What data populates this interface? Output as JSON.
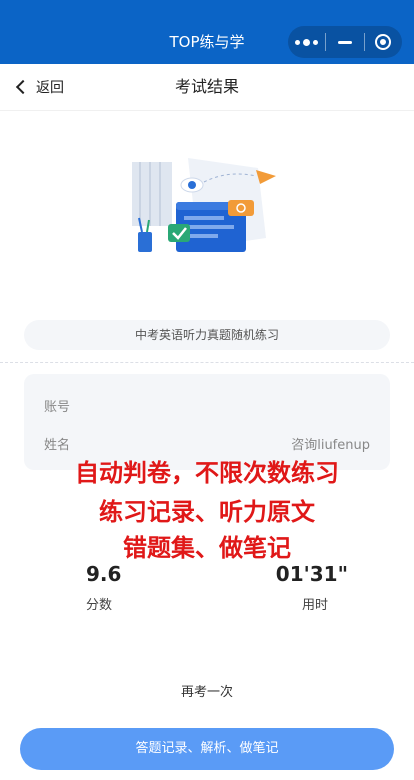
{
  "app": {
    "title": "TOP练与学"
  },
  "nav": {
    "back_label": "返回",
    "title": "考试结果"
  },
  "exam": {
    "name": "中考英语听力真题随机练习"
  },
  "info": {
    "account_label": "账号",
    "account_value": "",
    "name_label": "姓名",
    "name_value": "咨询liufenup"
  },
  "overlay": {
    "line1": "自动判卷，不限次数练习",
    "line2": "练习记录、听力原文",
    "line3": "错题集、做笔记"
  },
  "result": {
    "score_value": "9.6",
    "score_label": "分数",
    "time_value": "01'31\"",
    "time_label": "用时"
  },
  "actions": {
    "retake_label": "再考一次",
    "records_label": "答题记录、解析、做笔记"
  },
  "colors": {
    "topbar": "#0b64c6",
    "cta": "#5a9bf6",
    "overlay_text": "#e01818"
  },
  "icons": [
    "more-icon",
    "minimize-icon",
    "close-target-icon",
    "back-chevron-icon",
    "exam-illustration"
  ]
}
